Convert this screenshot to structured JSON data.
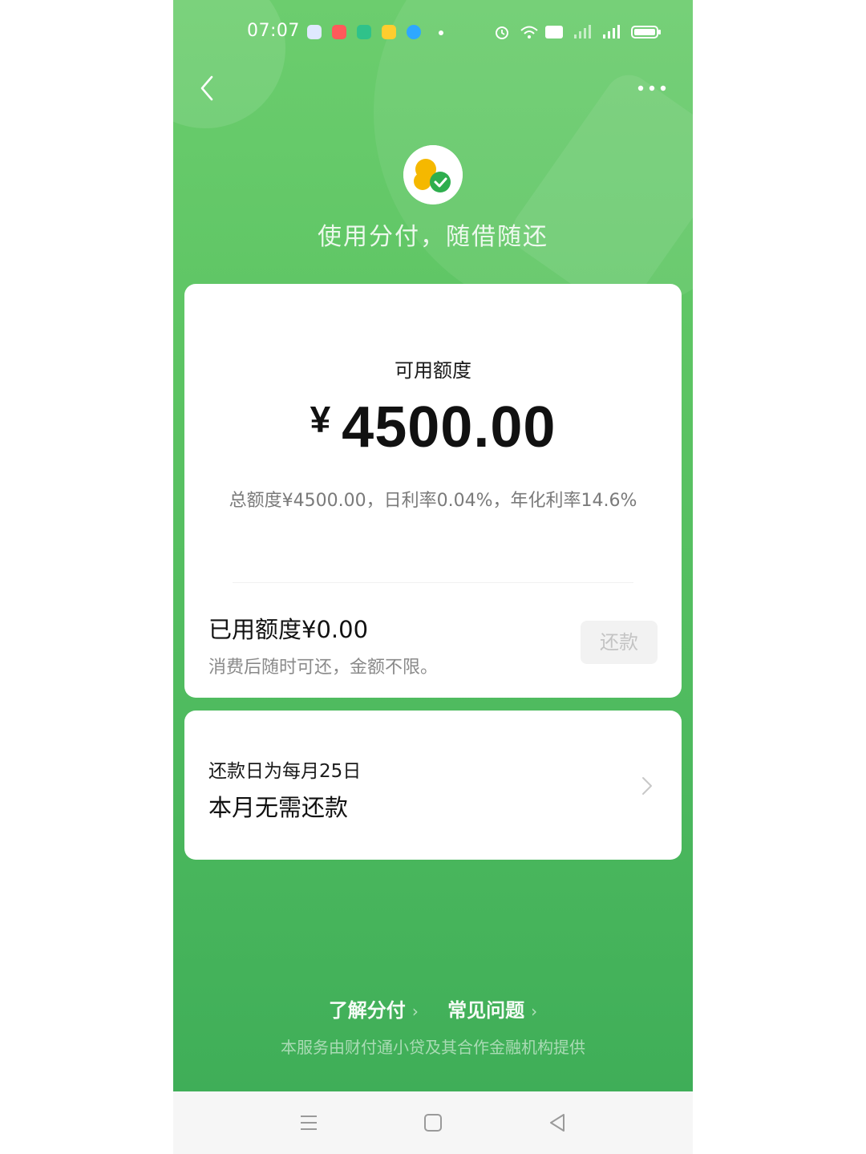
{
  "status_bar": {
    "time": "07:07"
  },
  "nav": {
    "back_icon": "chevron-left-icon",
    "more_icon": "more-horizontal-icon"
  },
  "brand": {
    "slogan": "使用分付，随借随还"
  },
  "credit": {
    "label": "可用额度",
    "currency": "¥",
    "amount": "4500.00",
    "detail": "总额度¥4500.00，日利率0.04%，年化利率14.6%",
    "used_label": "已用额度¥0.00",
    "used_hint": "消费后随时可还，金额不限。",
    "repay_button": "还款"
  },
  "repay_info": {
    "day_text": "还款日为每月25日",
    "status_text": "本月无需还款"
  },
  "footer": {
    "links": [
      {
        "label": "了解分付"
      },
      {
        "label": "常见问题"
      }
    ],
    "note": "本服务由财付通小贷及其合作金融机构提供"
  },
  "colors": {
    "primary_green": "#5cc463",
    "disabled_button_bg": "#f2f2f2",
    "disabled_button_text": "#c4c4c4"
  }
}
